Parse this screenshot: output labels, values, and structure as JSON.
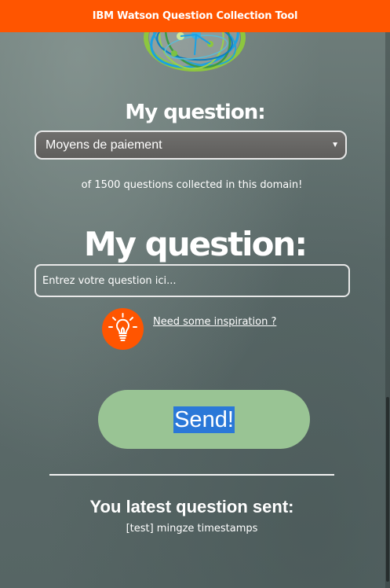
{
  "header": {
    "title": "IBM Watson Question Collection Tool"
  },
  "domain_section": {
    "title": "My question:",
    "select_value": "Moyens de paiement",
    "count_text": "of 1500 questions collected in this domain!"
  },
  "question_section": {
    "title": "My question:",
    "input_placeholder": "Entrez votre question ici...",
    "input_value": "",
    "inspiration_link": "Need some inspiration ?"
  },
  "send_button": {
    "label": "Send!"
  },
  "latest": {
    "title": "You latest question sent:",
    "value": "[test] mingze timestamps"
  },
  "colors": {
    "header": "#ff5500",
    "send_button": "#99c494",
    "inspiration_icon": "#ff5500",
    "selection_highlight": "#2a78d8"
  },
  "icons": {
    "logo": "watson-globe-icon",
    "inspiration": "lightbulb-icon",
    "select_arrow": "caret-down-icon"
  }
}
